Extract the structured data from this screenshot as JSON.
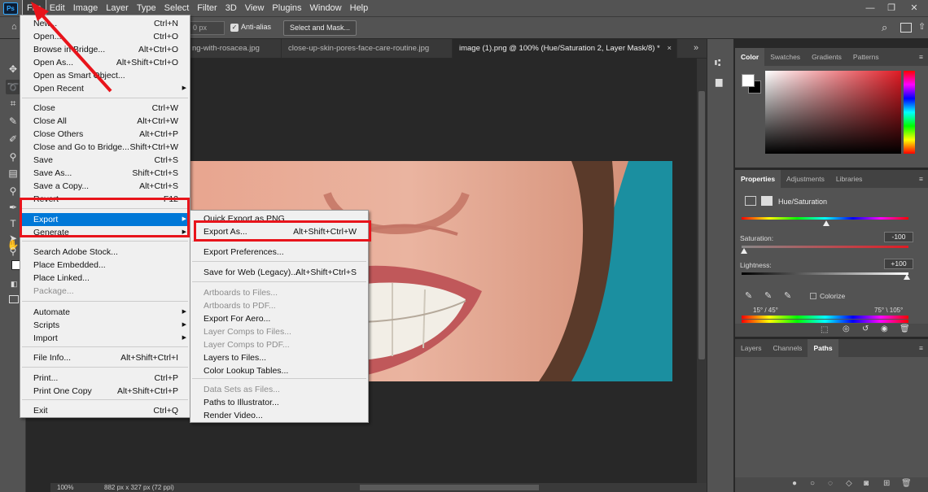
{
  "app": {
    "logo": "Ps"
  },
  "menubar": [
    "File",
    "Edit",
    "Image",
    "Layer",
    "Type",
    "Select",
    "Filter",
    "3D",
    "View",
    "Plugins",
    "Window",
    "Help"
  ],
  "window_controls": {
    "minimize": "—",
    "restore": "❐",
    "close": "✕"
  },
  "optbar": {
    "feather_value": "0 px",
    "antialias_label": "Anti-alias",
    "select_mask_label": "Select and Mask..."
  },
  "tabs": [
    {
      "label": "ng-with-rosacea.jpg",
      "active": false
    },
    {
      "label": "close-up-skin-pores-face-care-routine.jpg",
      "active": false
    },
    {
      "label": "image (1).png @ 100% (Hue/Saturation 2, Layer Mask/8) *",
      "active": true
    }
  ],
  "tab_close": "×",
  "tab_overflow": "»",
  "status": {
    "zoom": "100%",
    "info": "882 px x 327 px (72 ppi)"
  },
  "file_menu": [
    {
      "label": "New...",
      "shortcut": "Ctrl+N"
    },
    {
      "label": "Open...",
      "shortcut": "Ctrl+O"
    },
    {
      "label": "Browse in Bridge...",
      "shortcut": "Alt+Ctrl+O"
    },
    {
      "label": "Open As...",
      "shortcut": "Alt+Shift+Ctrl+O"
    },
    {
      "label": "Open as Smart Object...",
      "shortcut": ""
    },
    {
      "label": "Open Recent",
      "shortcut": "",
      "submenu": true
    },
    {
      "label": "Close",
      "shortcut": "Ctrl+W"
    },
    {
      "label": "Close All",
      "shortcut": "Alt+Ctrl+W"
    },
    {
      "label": "Close Others",
      "shortcut": "Alt+Ctrl+P"
    },
    {
      "label": "Close and Go to Bridge...",
      "shortcut": "Shift+Ctrl+W"
    },
    {
      "label": "Save",
      "shortcut": "Ctrl+S"
    },
    {
      "label": "Save As...",
      "shortcut": "Shift+Ctrl+S"
    },
    {
      "label": "Save a Copy...",
      "shortcut": "Alt+Ctrl+S"
    },
    {
      "label": "Revert",
      "shortcut": "F12"
    },
    {
      "label": "Export",
      "shortcut": "",
      "submenu": true,
      "selected": true
    },
    {
      "label": "Generate",
      "shortcut": "",
      "submenu": true
    },
    {
      "label": "Search Adobe Stock...",
      "shortcut": ""
    },
    {
      "label": "Place Embedded...",
      "shortcut": ""
    },
    {
      "label": "Place Linked...",
      "shortcut": ""
    },
    {
      "label": "Package...",
      "shortcut": "",
      "disabled": true
    },
    {
      "label": "Automate",
      "shortcut": "",
      "submenu": true
    },
    {
      "label": "Scripts",
      "shortcut": "",
      "submenu": true
    },
    {
      "label": "Import",
      "shortcut": "",
      "submenu": true
    },
    {
      "label": "File Info...",
      "shortcut": "Alt+Shift+Ctrl+I"
    },
    {
      "label": "Print...",
      "shortcut": "Ctrl+P"
    },
    {
      "label": "Print One Copy",
      "shortcut": "Alt+Shift+Ctrl+P"
    },
    {
      "label": "Exit",
      "shortcut": "Ctrl+Q"
    }
  ],
  "export_menu": [
    {
      "label": "Quick Export as PNG",
      "shortcut": ""
    },
    {
      "label": "Export As...",
      "shortcut": "Alt+Shift+Ctrl+W"
    },
    {
      "label": "Export Preferences...",
      "shortcut": ""
    },
    {
      "label": "Save for Web (Legacy)...",
      "shortcut": "Alt+Shift+Ctrl+S"
    },
    {
      "label": "Artboards to Files...",
      "shortcut": "",
      "disabled": true
    },
    {
      "label": "Artboards to PDF...",
      "shortcut": "",
      "disabled": true
    },
    {
      "label": "Export For Aero...",
      "shortcut": ""
    },
    {
      "label": "Layer Comps to Files...",
      "shortcut": "",
      "disabled": true
    },
    {
      "label": "Layer Comps to PDF...",
      "shortcut": "",
      "disabled": true
    },
    {
      "label": "Layers to Files...",
      "shortcut": ""
    },
    {
      "label": "Color Lookup Tables...",
      "shortcut": ""
    },
    {
      "label": "Data Sets as Files...",
      "shortcut": "",
      "disabled": true
    },
    {
      "label": "Paths to Illustrator...",
      "shortcut": ""
    },
    {
      "label": "Render Video...",
      "shortcut": ""
    }
  ],
  "color_panel": {
    "tabs": [
      "Color",
      "Swatches",
      "Gradients",
      "Patterns"
    ]
  },
  "properties_panel": {
    "tabs": [
      "Properties",
      "Adjustments",
      "Libraries"
    ],
    "title": "Hue/Saturation",
    "saturation_label": "Saturation:",
    "saturation_value": "-100",
    "lightness_label": "Lightness:",
    "lightness_value": "+100",
    "colorize_label": "Colorize",
    "range_left": "15° / 45°",
    "range_right": "75° \\ 105°"
  },
  "layers_panel": {
    "tabs": [
      "Layers",
      "Channels",
      "Paths"
    ]
  },
  "colors": {
    "highlight": "#e8141b",
    "menu_selected": "#0078d7",
    "photo_bg": "#1b8fa0"
  }
}
